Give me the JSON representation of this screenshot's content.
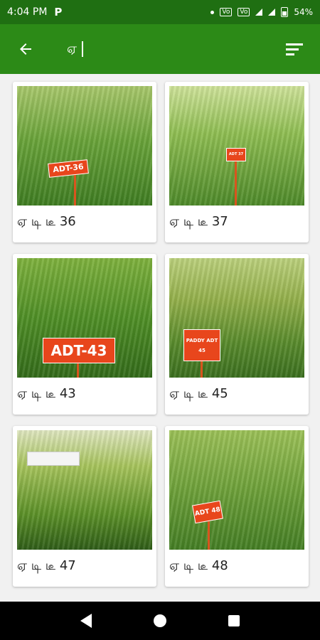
{
  "status_bar": {
    "time": "4:04 PM",
    "app_badge": "P",
    "vo1": "Vo",
    "vo2": "Vo",
    "battery": "54%"
  },
  "app_bar": {
    "search_value": "ஏ",
    "back_icon": "arrow-left-icon",
    "menu_icon": "sort-icon"
  },
  "cards": [
    {
      "caption": "ஏ டி டீ 36",
      "sign": "ADT-36"
    },
    {
      "caption": "ஏ டி டீ 37",
      "sign": "ADT 37"
    },
    {
      "caption": "ஏ டி டீ 43",
      "sign": "ADT-43"
    },
    {
      "caption": "ஏ டி டீ 45",
      "sign": "PADDY ADT 45"
    },
    {
      "caption": "ஏ டி டீ 47",
      "sign": ""
    },
    {
      "caption": "ஏ டி டீ 48",
      "sign": "ADT 48"
    }
  ],
  "colors": {
    "status_bar": "#1f6f12",
    "app_bar": "#2c8a17",
    "background": "#f1f1f1"
  }
}
